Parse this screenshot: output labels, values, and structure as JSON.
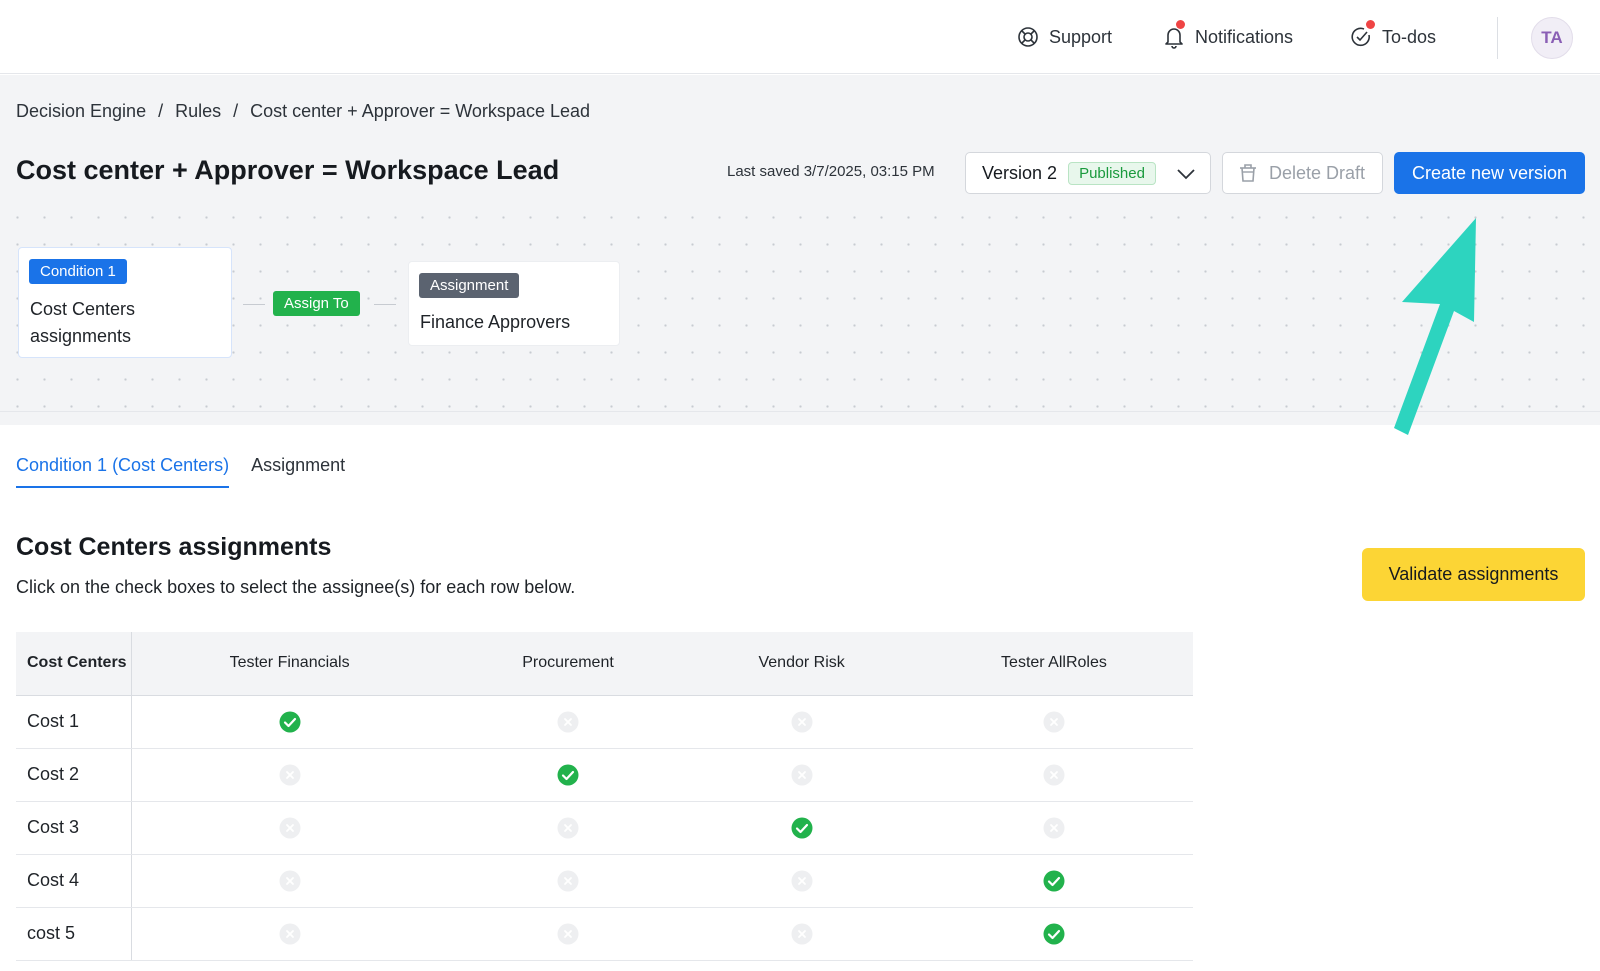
{
  "topbar": {
    "support": "Support",
    "notifications": "Notifications",
    "todos": "To-dos",
    "avatar_initials": "TA"
  },
  "breadcrumb": {
    "items": [
      "Decision Engine",
      "Rules",
      "Cost center + Approver = Workspace Lead"
    ],
    "separator": "/"
  },
  "header": {
    "title": "Cost center + Approver = Workspace Lead",
    "last_saved": "Last saved 3/7/2025, 03:15 PM",
    "version_label": "Version 2",
    "version_status": "Published",
    "delete_draft": "Delete Draft",
    "create_new_version": "Create new version"
  },
  "flow": {
    "condition_tag": "Condition 1",
    "condition_text": "Cost Centers assignments",
    "assign_chip": "Assign To",
    "assignment_tag": "Assignment",
    "assignment_text": "Finance Approvers"
  },
  "tabs": [
    {
      "label": "Condition 1 (Cost Centers)",
      "active": true
    },
    {
      "label": "Assignment",
      "active": false
    }
  ],
  "section": {
    "title": "Cost Centers assignments",
    "subtitle": "Click on the check boxes to select the assignee(s) for each row below.",
    "validate_button": "Validate assignments"
  },
  "table": {
    "columns": [
      "Cost Centers",
      "Tester Financials",
      "Procurement",
      "Vendor Risk",
      "Tester AllRoles"
    ],
    "rows": [
      {
        "name": "Cost 1",
        "checks": [
          true,
          false,
          false,
          false
        ]
      },
      {
        "name": "Cost 2",
        "checks": [
          false,
          true,
          false,
          false
        ]
      },
      {
        "name": "Cost 3",
        "checks": [
          false,
          false,
          true,
          false
        ]
      },
      {
        "name": "Cost 4",
        "checks": [
          false,
          false,
          false,
          true
        ]
      },
      {
        "name": "cost 5",
        "checks": [
          false,
          false,
          false,
          true
        ]
      }
    ]
  },
  "colors": {
    "primary": "#1a73e8",
    "success": "#22b24c",
    "warning": "#fcd535",
    "annotation_arrow": "#2dd4bf"
  },
  "icons": {
    "support": "lifebuoy-icon",
    "notifications": "bell-icon",
    "todos": "check-circle-icon",
    "version_chevron": "chevron-down-icon",
    "delete_draft": "trash-icon",
    "checked": "check-circle-filled-icon",
    "unchecked": "x-circle-icon"
  }
}
